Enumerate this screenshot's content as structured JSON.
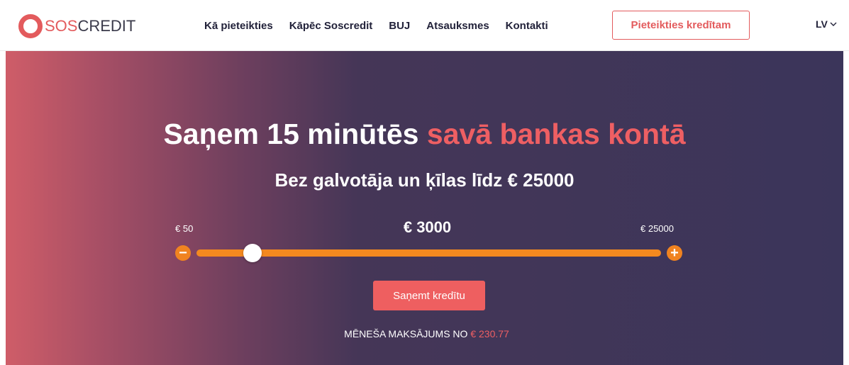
{
  "header": {
    "logo": {
      "sos": "SOS",
      "credit": "CREDIT"
    },
    "nav": [
      {
        "label": "Kā pieteikties"
      },
      {
        "label": "Kāpēc Soscredit"
      },
      {
        "label": "BUJ"
      },
      {
        "label": "Atsauksmes"
      },
      {
        "label": "Kontakti"
      }
    ],
    "cta_label": "Pieteikties kredītam",
    "language": "LV"
  },
  "hero": {
    "headline_main": "Saņem 15 minūtēs",
    "headline_accent": "savā bankas kontā",
    "subheadline": "Bez galvotāja un ķīlas līdz € 25000",
    "slider": {
      "min_label": "€ 50",
      "max_label": "€ 25000",
      "value_label": "€ 3000",
      "value": 3000,
      "min": 50,
      "max": 25000
    },
    "apply_label": "Saņemt kredītu",
    "monthly_label": "MĒNEŠA MAKSĀJUMS NO",
    "monthly_value": "€ 230.77"
  },
  "colors": {
    "accent": "#ee5f63",
    "slider": "#f4891f",
    "hero_dark": "#3b355a",
    "hero_light": "#cf5d68"
  }
}
